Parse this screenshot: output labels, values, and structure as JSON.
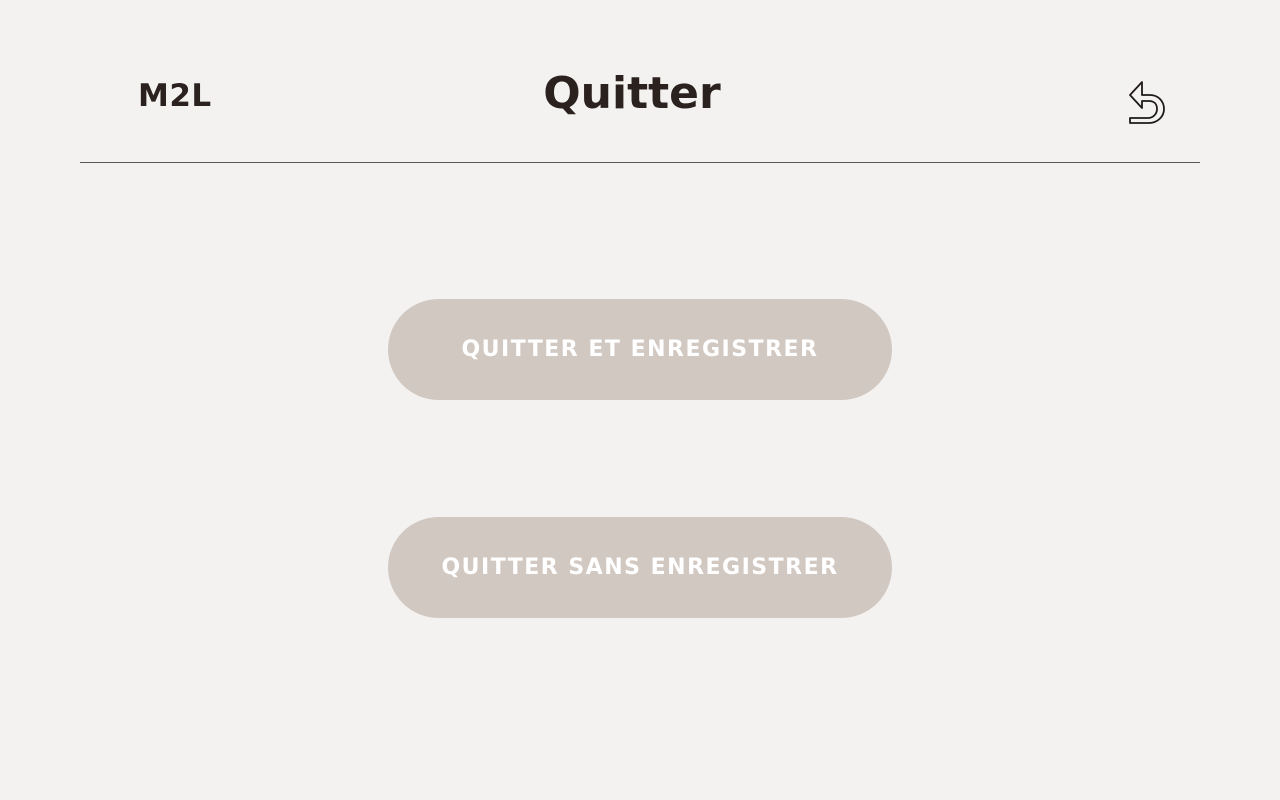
{
  "header": {
    "brand": "M2L",
    "title": "Quitter",
    "back_icon": "back-arrow-icon"
  },
  "actions": {
    "quit_and_save_label": "QUITTER ET ENREGISTRER",
    "quit_without_save_label": "QUITTER SANS ENREGISTRER"
  },
  "colors": {
    "background": "#f4f2f0",
    "text_dark": "#2b2220",
    "button_bg": "#d2c8c2",
    "button_text": "#ffffff",
    "divider": "#5b5553"
  }
}
